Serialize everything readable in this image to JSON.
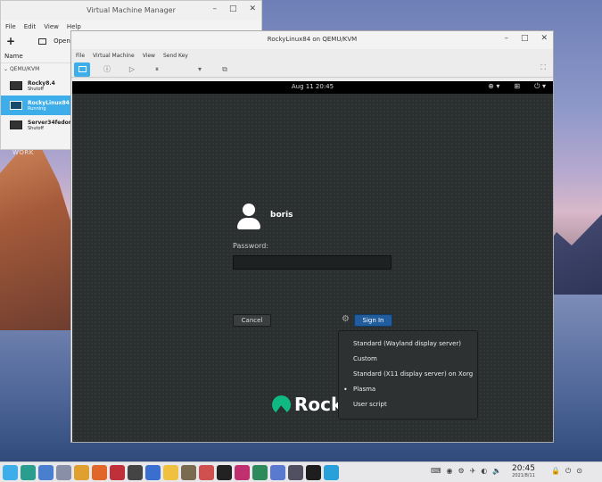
{
  "wallpaper": {
    "label": "WORK"
  },
  "vmm": {
    "title": "Virtual Machine Manager",
    "menu": [
      "File",
      "Edit",
      "View",
      "Help"
    ],
    "toolbar": {
      "open_label": "Open"
    },
    "column_header": "Name",
    "connection": "QEMU/KVM",
    "vms": [
      {
        "name": "Rocky8.4",
        "status": "Shutoff",
        "selected": false
      },
      {
        "name": "RockyLinux84",
        "status": "Running",
        "selected": true
      },
      {
        "name": "Server34fedora",
        "status": "Shutoff",
        "selected": false
      }
    ]
  },
  "console": {
    "title": "RockyLinux84 on QEMU/KVM",
    "menu": [
      "File",
      "Virtual Machine",
      "View",
      "Send Key"
    ]
  },
  "guest": {
    "clock": "Aug 11  20:45",
    "username": "boris",
    "password_label": "Password:",
    "cancel_label": "Cancel",
    "signin_label": "Sign In",
    "logo_text": "Rock",
    "sessions": [
      {
        "label": "Standard (Wayland display server)",
        "selected": false
      },
      {
        "label": "Custom",
        "selected": false
      },
      {
        "label": "Standard (X11 display server) on Xorg",
        "selected": false
      },
      {
        "label": "Plasma",
        "selected": true
      },
      {
        "label": "User script",
        "selected": false
      }
    ]
  },
  "taskbar": {
    "time": "20:45",
    "date": "2021/8/11",
    "apps": [
      {
        "icon": "launcher-icon",
        "color": "#3daee9"
      },
      {
        "icon": "terminal-icon",
        "color": "#2a9d8f"
      },
      {
        "icon": "store-icon",
        "color": "#4a7fcf"
      },
      {
        "icon": "settings-icon",
        "color": "#8a8fa8"
      },
      {
        "icon": "chrome-icon",
        "color": "#e0a030"
      },
      {
        "icon": "firefox-icon",
        "color": "#e0662a"
      },
      {
        "icon": "konsole-icon",
        "color": "#c0303a"
      },
      {
        "icon": "vm-icon",
        "color": "#444444"
      },
      {
        "icon": "browser-icon",
        "color": "#3a6fd0"
      },
      {
        "icon": "notes-icon",
        "color": "#f0c040"
      },
      {
        "icon": "gimp-icon",
        "color": "#7a6a50"
      },
      {
        "icon": "photos-icon",
        "color": "#d05050"
      },
      {
        "icon": "ide-icon",
        "color": "#222222"
      },
      {
        "icon": "music-icon",
        "color": "#c03070"
      },
      {
        "icon": "vim-icon",
        "color": "#2e8a5a"
      },
      {
        "icon": "editor-icon",
        "color": "#5a7ad0"
      },
      {
        "icon": "mail-icon",
        "color": "#505060"
      },
      {
        "icon": "pycharm-icon",
        "color": "#1e1e1e"
      },
      {
        "icon": "telegram-icon",
        "color": "#2aa0da"
      }
    ]
  }
}
